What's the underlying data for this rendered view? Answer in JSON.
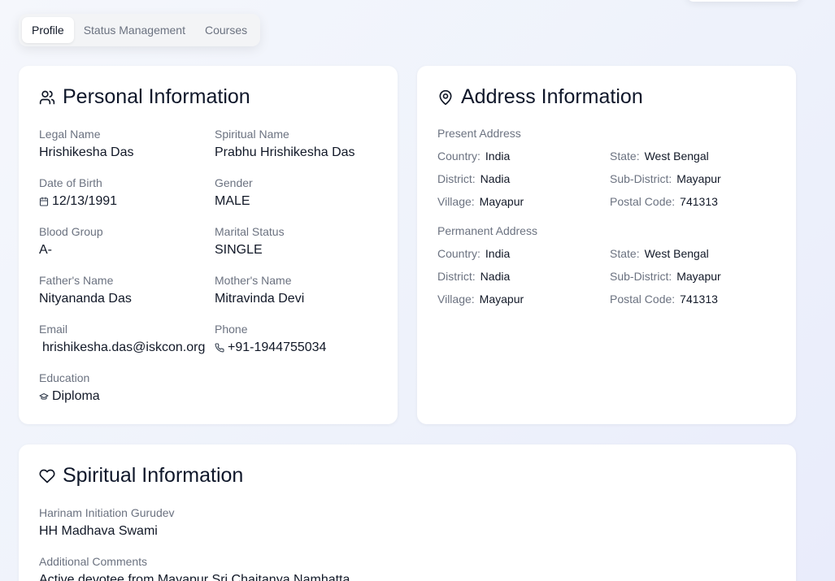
{
  "tabs": [
    {
      "label": "Profile",
      "active": true
    },
    {
      "label": "Status Management",
      "active": false
    },
    {
      "label": "Courses",
      "active": false
    }
  ],
  "personal": {
    "title": "Personal Information",
    "icon": "users-icon",
    "legal_name": {
      "label": "Legal Name",
      "value": "Hrishikesha Das"
    },
    "spiritual_name": {
      "label": "Spiritual Name",
      "value": "Prabhu Hrishikesha Das"
    },
    "dob": {
      "label": "Date of Birth",
      "value": "12/13/1991",
      "icon": "calendar-icon"
    },
    "gender": {
      "label": "Gender",
      "value": "MALE"
    },
    "blood_group": {
      "label": "Blood Group",
      "value": "A-"
    },
    "marital_status": {
      "label": "Marital Status",
      "value": "SINGLE"
    },
    "father": {
      "label": "Father's Name",
      "value": "Nityananda Das"
    },
    "mother": {
      "label": "Mother's Name",
      "value": "Mitravinda Devi"
    },
    "email": {
      "label": "Email",
      "value": "hrishikesha.das@iskcon.org",
      "icon": "mail-icon"
    },
    "phone": {
      "label": "Phone",
      "value": "+91-1944755034",
      "icon": "phone-icon"
    },
    "education": {
      "label": "Education",
      "value": "Diploma",
      "icon": "graduation-cap-icon"
    }
  },
  "address": {
    "title": "Address Information",
    "icon": "map-pin-icon",
    "present": {
      "heading": "Present Address",
      "country_label": "Country:",
      "country": "India",
      "state_label": "State:",
      "state": "West Bengal",
      "district_label": "District:",
      "district": "Nadia",
      "subdistrict_label": "Sub-District:",
      "subdistrict": "Mayapur",
      "village_label": "Village:",
      "village": "Mayapur",
      "postal_label": "Postal Code:",
      "postal": "741313"
    },
    "permanent": {
      "heading": "Permanent Address",
      "country_label": "Country:",
      "country": "India",
      "state_label": "State:",
      "state": "West Bengal",
      "district_label": "District:",
      "district": "Nadia",
      "subdistrict_label": "Sub-District:",
      "subdistrict": "Mayapur",
      "village_label": "Village:",
      "village": "Mayapur",
      "postal_label": "Postal Code:",
      "postal": "741313"
    }
  },
  "spiritual": {
    "title": "Spiritual Information",
    "icon": "heart-icon",
    "gurudev": {
      "label": "Harinam Initiation Gurudev",
      "value": "HH Madhava Swami"
    },
    "comments": {
      "label": "Additional Comments",
      "value": "Active devotee from Mayapur Sri Chaitanya Namhatta"
    }
  }
}
